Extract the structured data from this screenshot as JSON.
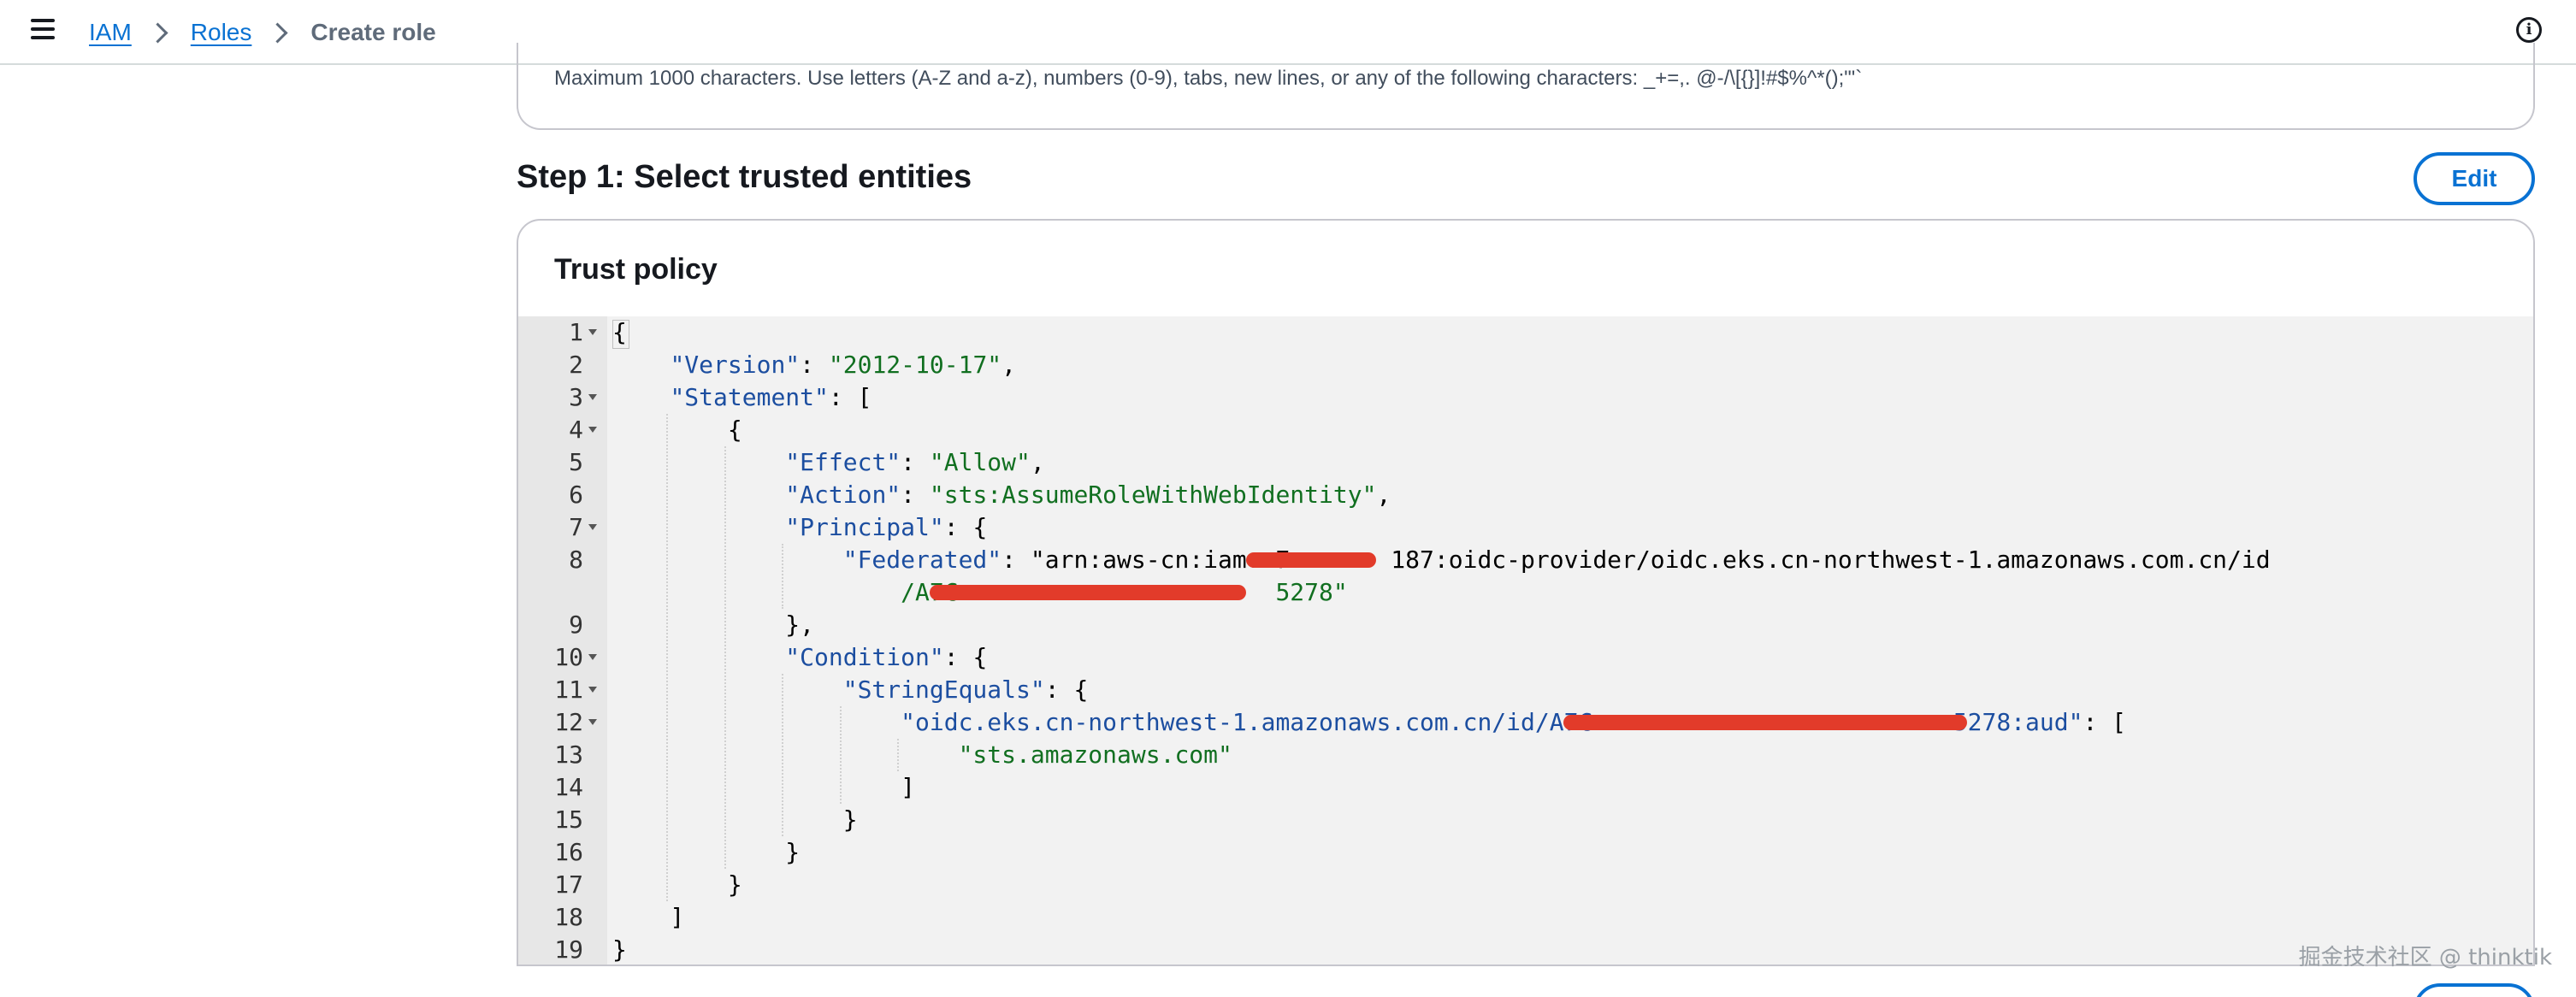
{
  "breadcrumb": {
    "items": [
      "IAM",
      "Roles"
    ],
    "current": "Create role"
  },
  "description_hint": "Maximum 1000 characters. Use letters (A-Z and a-z), numbers (0-9), tabs, new lines, or any of the following characters: _+=,. @-/\\[{}]!#$%^*();\"'`",
  "step": {
    "title": "Step 1: Select trusted entities",
    "edit_label": "Edit"
  },
  "policy": {
    "title": "Trust policy",
    "line_numbers": [
      "1",
      "2",
      "3",
      "4",
      "5",
      "6",
      "7",
      "8",
      "",
      "9",
      "10",
      "11",
      "12",
      "13",
      "14",
      "15",
      "16",
      "17",
      "18",
      "19"
    ],
    "lines": [
      "{",
      "    \"Version\": \"2012-10-17\",",
      "    \"Statement\": [",
      "        {",
      "            \"Effect\": \"Allow\",",
      "            \"Action\": \"sts:AssumeRoleWithWebIdentity\",",
      "            \"Principal\": {",
      "                \"Federated\": \"arn:aws-cn:iam::7       187:oidc-provider/oidc.eks.cn-northwest-1.amazonaws.com.cn/id",
      "                    /A7C                      5278\"",
      "            },",
      "            \"Condition\": {",
      "                \"StringEquals\": {",
      "                    \"oidc.eks.cn-northwest-1.amazonaws.com.cn/id/A7C                         5278:aud\": [",
      "                        \"sts.amazonaws.com\"",
      "                    ]",
      "                }",
      "            }",
      "        }",
      "    ]",
      "}"
    ]
  },
  "watermark": "掘金技术社区 @ thinktik"
}
